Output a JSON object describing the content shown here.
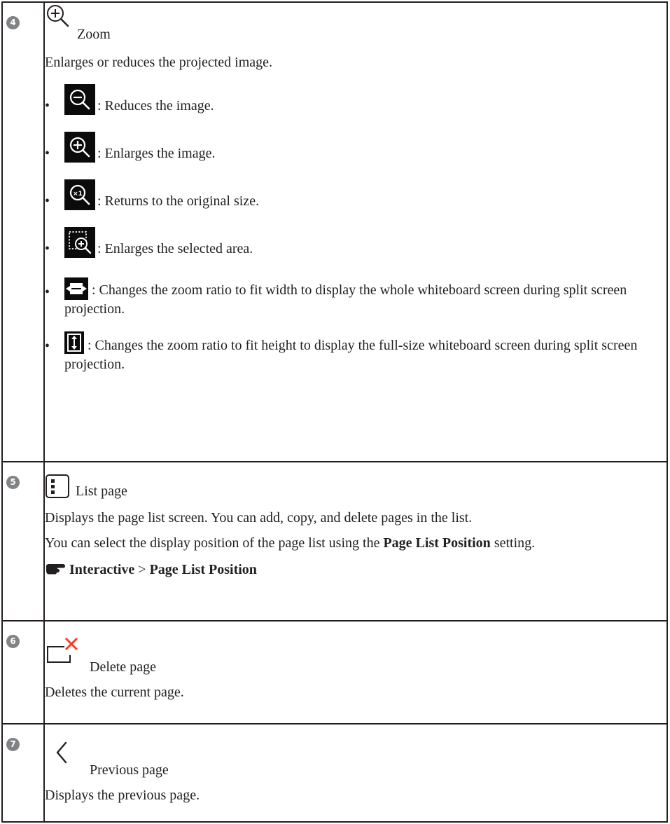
{
  "rows": [
    {
      "number": "4",
      "icon": "zoom-in-icon",
      "title": "Zoom",
      "description": "Enlarges or reduces the projected image.",
      "bullets": [
        {
          "icon": "zoom-out-icon",
          "text": ": Reduces the image."
        },
        {
          "icon": "zoom-in-icon",
          "text": ": Enlarges the image."
        },
        {
          "icon": "zoom-original-size-icon",
          "text": ": Returns to the original size."
        },
        {
          "icon": "zoom-selected-area-icon",
          "text": ": Enlarges the selected area."
        },
        {
          "icon": "fit-width-icon",
          "text": ": Changes the zoom ratio to fit width to display the whole whiteboard screen during split screen projection."
        },
        {
          "icon": "fit-height-icon",
          "text": ": Changes the zoom ratio to fit height to display the full-size whiteboard screen during split screen projection."
        }
      ]
    },
    {
      "number": "5",
      "icon": "list-page-icon",
      "title": "List page",
      "description": "Displays the page list screen. You can add, copy, and delete pages in the list.",
      "description2_pre": "You can select the display position of the page list using the ",
      "description2_bold": "Page List Position",
      "description2_post": " setting.",
      "reference_icon": "pointing-hand-icon",
      "reference_menu": "Interactive",
      "reference_sep": ">",
      "reference_item": "Page List Position"
    },
    {
      "number": "6",
      "icon": "delete-page-icon",
      "title": "Delete page",
      "description": "Deletes the current page."
    },
    {
      "number": "7",
      "icon": "previous-page-icon",
      "title": "Previous page",
      "description": "Displays the previous page."
    }
  ],
  "colors": {
    "text": "#231f20",
    "badge": "#808285",
    "delete_accent": "#ff3b1f",
    "button_bg": "#0b0b0b"
  }
}
